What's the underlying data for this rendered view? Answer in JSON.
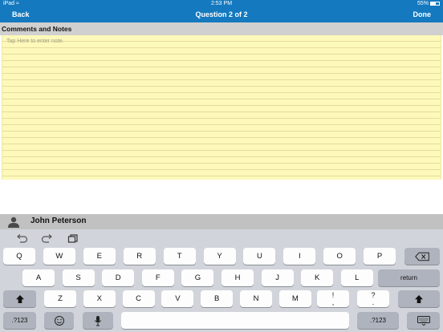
{
  "status_bar": {
    "carrier": "iPad",
    "time": "2:53 PM",
    "battery": "55%",
    "battery_level": 0.55
  },
  "nav": {
    "back_label": "Back",
    "title": "Question 2 of 2",
    "done_label": "Done"
  },
  "section": {
    "title": "Comments and Notes"
  },
  "notes": {
    "placeholder": "Tap Here to enter note."
  },
  "user": {
    "name": "John Peterson",
    "icon": "person-icon"
  },
  "keyboard": {
    "toolbar_icons": [
      "undo-icon",
      "redo-icon",
      "paste-icon"
    ],
    "row1": [
      "Q",
      "W",
      "E",
      "R",
      "T",
      "Y",
      "U",
      "I",
      "O",
      "P"
    ],
    "row2": [
      "A",
      "S",
      "D",
      "F",
      "G",
      "H",
      "J",
      "K",
      "L"
    ],
    "row3": [
      "Z",
      "X",
      "C",
      "V",
      "B",
      "N",
      "M"
    ],
    "punct1": {
      "top": "!",
      "bottom": ","
    },
    "punct2": {
      "top": "?",
      "bottom": "."
    },
    "return_label": "return",
    "numbers_label": ".?123",
    "icons": {
      "backspace": "backspace-icon",
      "shift": "shift-icon",
      "emoji": "emoji-icon",
      "mic": "microphone-icon",
      "hide": "keyboard-hide-icon"
    }
  }
}
